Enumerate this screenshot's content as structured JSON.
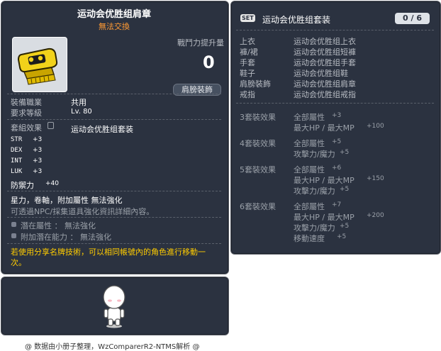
{
  "item_id": "01152074",
  "item": {
    "name": "运动会优胜组肩章",
    "trade_status": "無法交換",
    "power_label": "戰鬥力提升量",
    "power_value": "0",
    "category_label": "肩膀裝飾",
    "job_label": "裝備職業",
    "job_value": "共用",
    "level_label": "要求等級",
    "level_value": "Lv. 80",
    "set_label": "套組效果",
    "set_name": "运动会优胜组套装",
    "stats": [
      {
        "name": "STR",
        "value": "+3"
      },
      {
        "name": "DEX",
        "value": "+3"
      },
      {
        "name": "INT",
        "value": "+3"
      },
      {
        "name": "LUK",
        "value": "+3"
      }
    ],
    "defense_label": "防禦力",
    "defense_value": "+40",
    "notes_line1": "星力，卷軸，附加屬性 無法強化",
    "notes_line2": "可透過NPC/採集道具強化資訊詳細內容。",
    "potential_label": "潛在屬性 ： 無法強化",
    "additional_potential_label": "附加潛在能力 ： 無法強化",
    "share_note_line1": "若使用分享名牌技術，可以相同帳號內的角色進行移動一",
    "share_note_line2": "次。"
  },
  "set_panel": {
    "badge": "SET",
    "name": "运动会优胜组套装",
    "count": "0 / 6",
    "pieces": [
      {
        "slot": "上衣",
        "name": "运动会优胜组上衣"
      },
      {
        "slot": "褲/裙",
        "name": "运动会优胜组短褲"
      },
      {
        "slot": "手套",
        "name": "运动会优胜组手套"
      },
      {
        "slot": "鞋子",
        "name": "运动会优胜组鞋"
      },
      {
        "slot": "肩膀裝飾",
        "name": "运动会优胜组肩章"
      },
      {
        "slot": "戒指",
        "name": "运动会优胜组戒指"
      }
    ],
    "effects": [
      {
        "title": "3套裝效果",
        "lines": [
          {
            "label": "全部屬性",
            "value": "+3"
          },
          {
            "label": "最大HP / 最大MP",
            "value": "+100"
          }
        ]
      },
      {
        "title": "4套裝效果",
        "lines": [
          {
            "label": "全部屬性",
            "value": "+5"
          },
          {
            "label": "攻擊力/魔力",
            "value": "+5"
          }
        ]
      },
      {
        "title": "5套裝效果",
        "lines": [
          {
            "label": "全部屬性",
            "value": "+6"
          },
          {
            "label": "最大HP / 最大MP",
            "value": "+150"
          },
          {
            "label": "攻擊力/魔力",
            "value": "+5"
          }
        ]
      },
      {
        "title": "6套裝效果",
        "lines": [
          {
            "label": "全部屬性",
            "value": "+7"
          },
          {
            "label": "最大HP / 最大MP",
            "value": "+200"
          },
          {
            "label": "攻擊力/魔力",
            "value": "+5"
          },
          {
            "label": "移動速度",
            "value": "+5"
          }
        ]
      }
    ]
  },
  "footer": "@ 数据由小册子整理，WzComparerR2-NTMS解析 @",
  "colors": {
    "panel_bg": "#2b3240",
    "title_orange": "#ff9a33",
    "notice_yellow": "#ffcc00",
    "label_gray": "#b7bbc2"
  }
}
